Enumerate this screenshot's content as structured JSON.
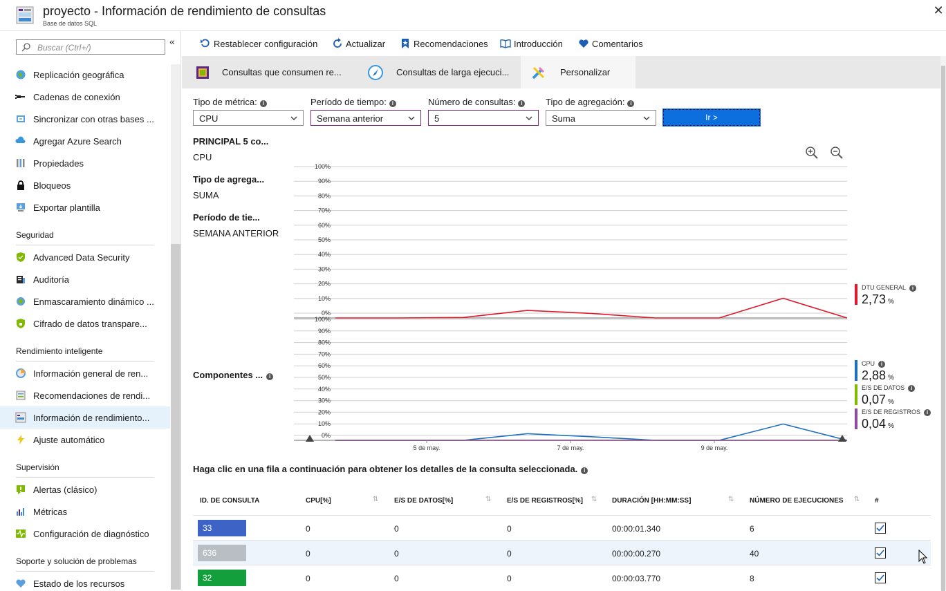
{
  "window": {
    "title": "proyecto - Información de rendimiento de consultas",
    "subtitle": "Base de datos SQL",
    "close": "✕"
  },
  "sidebar": {
    "search_placeholder": "Buscar (Ctrl+/)",
    "collapse": "«",
    "items_top": [
      {
        "label": "Replicación geográfica",
        "icon": "globe-icon"
      },
      {
        "label": "Cadenas de conexión",
        "icon": "plug-icon"
      },
      {
        "label": "Sincronizar con otras bases ...",
        "icon": "sync-icon"
      },
      {
        "label": "Agregar Azure Search",
        "icon": "cloud-search-icon"
      },
      {
        "label": "Propiedades",
        "icon": "properties-icon"
      },
      {
        "label": "Bloqueos",
        "icon": "lock-icon"
      },
      {
        "label": "Exportar plantilla",
        "icon": "export-icon"
      }
    ],
    "section_security": "Seguridad",
    "items_security": [
      {
        "label": "Advanced Data Security",
        "icon": "shield-icon"
      },
      {
        "label": "Auditoría",
        "icon": "audit-icon"
      },
      {
        "label": "Enmascaramiento dinámico ...",
        "icon": "mask-icon"
      },
      {
        "label": "Cifrado de datos transpare...",
        "icon": "encryption-shield-icon"
      }
    ],
    "section_perf": "Rendimiento inteligente",
    "items_perf": [
      {
        "label": "Información general de ren...",
        "icon": "overview-icon"
      },
      {
        "label": "Recomendaciones de rendi...",
        "icon": "recommendations-icon"
      },
      {
        "label": "Información de rendimiento...",
        "icon": "query-insight-icon"
      },
      {
        "label": "Ajuste automático",
        "icon": "lightning-icon"
      }
    ],
    "section_monitor": "Supervisión",
    "items_monitor": [
      {
        "label": "Alertas (clásico)",
        "icon": "alert-icon"
      },
      {
        "label": "Métricas",
        "icon": "metrics-icon"
      },
      {
        "label": "Configuración de diagnóstico",
        "icon": "diagnostics-icon"
      }
    ],
    "section_support": "Soporte y solución de problemas",
    "items_support": [
      {
        "label": "Estado de los recursos",
        "icon": "heart-icon"
      }
    ]
  },
  "toolbar": {
    "reset": "Restablecer configuración",
    "refresh": "Actualizar",
    "recommendations": "Recomendaciones",
    "intro": "Introducción",
    "feedback": "Comentarios"
  },
  "tabs": [
    {
      "label": "Consultas que consumen re..."
    },
    {
      "label": "Consultas de larga ejecuci..."
    },
    {
      "label": "Personalizar"
    }
  ],
  "filters": {
    "metric_label": "Tipo de métrica:",
    "metric_value": "CPU",
    "period_label": "Período de tiempo:",
    "period_value": "Semana anterior",
    "count_label": "Número de consultas:",
    "count_value": "5",
    "agg_label": "Tipo de agregación:",
    "agg_value": "Suma",
    "go": "Ir >"
  },
  "summary": {
    "top_label": "PRINCIPAL 5 co...",
    "top_value": "CPU",
    "agg_label": "Tipo de agrega...",
    "agg_value": "SUMA",
    "period_label": "Período de tie...",
    "period_value": "SEMANA ANTERIOR",
    "components_label": "Componentes ..."
  },
  "chart_data": {
    "type": "line",
    "y_ticks": [
      "100%",
      "90%",
      "80%",
      "70%",
      "60%",
      "50%",
      "40%",
      "30%",
      "20%",
      "10%",
      "0%"
    ],
    "x_ticks": [
      "5 de may.",
      "7 de may.",
      "9 de may."
    ],
    "x": [
      0,
      1,
      2,
      3,
      4,
      5,
      6,
      7,
      8
    ],
    "top_series": [
      {
        "name": "DTU GENERAL",
        "color": "#e0182b",
        "values": [
          0,
          0,
          0.3,
          5,
          3,
          0,
          0,
          13,
          0
        ]
      }
    ],
    "bottom_series": [
      {
        "name": "CPU",
        "color": "#1f6fc0",
        "values": [
          0,
          0,
          0,
          5.5,
          3,
          0,
          0,
          13.5,
          0
        ]
      },
      {
        "name": "E/S DE DATOS",
        "color": "#7fba00",
        "values": [
          0,
          0,
          0,
          0.1,
          0.1,
          0,
          0,
          0.1,
          0
        ]
      },
      {
        "name": "E/S DE REGISTROS",
        "color": "#8e4a9e",
        "values": [
          0,
          0,
          0,
          0.05,
          0.05,
          0,
          0,
          0.05,
          0
        ]
      }
    ]
  },
  "legend": {
    "dtu": {
      "name": "DTU GENERAL",
      "value": "2,73",
      "unit": "%"
    },
    "cpu": {
      "name": "CPU",
      "value": "2,88",
      "unit": "%"
    },
    "data_io": {
      "name": "E/S DE DATOS",
      "value": "0,07",
      "unit": "%"
    },
    "log_io": {
      "name": "E/S DE REGISTROS",
      "value": "0,04",
      "unit": "%"
    }
  },
  "table": {
    "hint": "Haga clic en una fila a continuación para obtener los detalles de la consulta seleccionada.",
    "headers": [
      "ID. DE CONSULTA",
      "CPU[%]",
      "E/S DE DATOS[%]",
      "E/S DE REGISTROS[%]",
      "DURACIÓN [HH:MM:SS]",
      "NÚMERO DE EJECUCIONES",
      "#"
    ],
    "sort_glyph": "⇅",
    "rows": [
      {
        "id": "33",
        "color": "#3d63c7",
        "cpu": "0",
        "data_io": "0",
        "log_io": "0",
        "duration": "00:00:01.340",
        "executions": "6"
      },
      {
        "id": "636",
        "color": "#b9bec5",
        "cpu": "0",
        "data_io": "0",
        "log_io": "0",
        "duration": "00:00:00.270",
        "executions": "40"
      },
      {
        "id": "32",
        "color": "#13a03c",
        "cpu": "0",
        "data_io": "0",
        "log_io": "0",
        "duration": "00:00:03.770",
        "executions": "8"
      }
    ]
  }
}
